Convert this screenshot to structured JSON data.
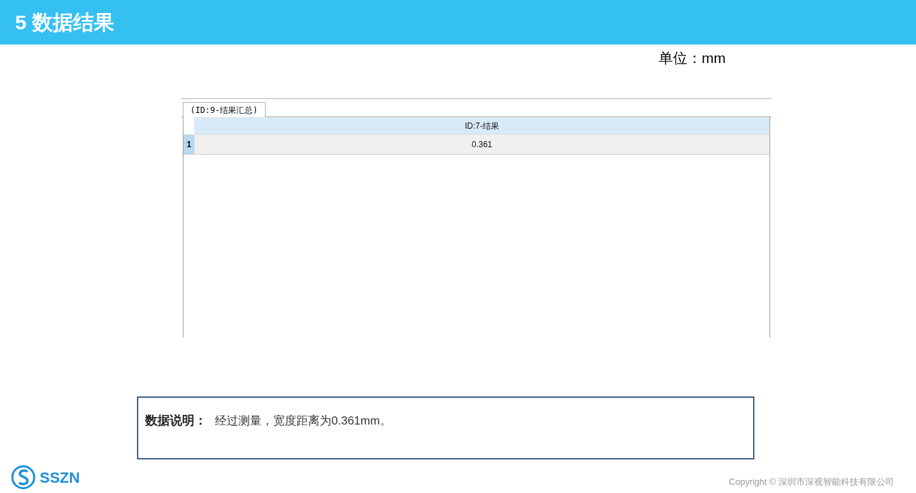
{
  "header": {
    "title": "5 数据结果"
  },
  "unit": "单位：mm",
  "result_window": {
    "tabs": [
      {
        "label": "(ID:9-结果汇总)",
        "selected": true
      }
    ],
    "table": {
      "columns": [
        "ID:7-结果"
      ],
      "rows": [
        {
          "index": "1",
          "cells": [
            "0.361"
          ]
        }
      ]
    }
  },
  "note": {
    "label": "数据说明：",
    "text": "经过测量，宽度距离为0.361mm。"
  },
  "footer": {
    "logo_text": "SSZN",
    "copyright": "Copyright © 深圳市深视智能科技有限公司"
  }
}
